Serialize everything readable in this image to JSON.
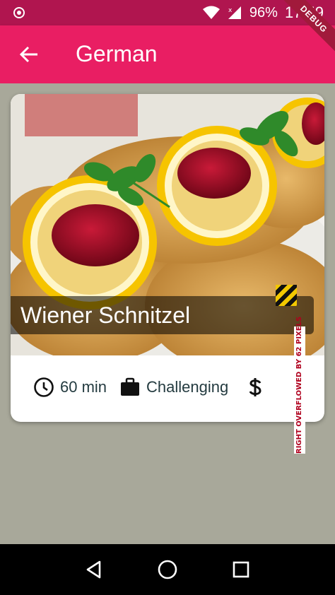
{
  "status_bar": {
    "battery": "96%",
    "time": "17:59"
  },
  "app_bar": {
    "title": "German",
    "debug_banner": "DEBUG"
  },
  "meal": {
    "title": "Wiener Schnitzel",
    "duration": "60 min",
    "complexity": "Challenging",
    "affordability_icon": "dollar-icon"
  },
  "overflow": {
    "label": "RIGHT OVERFLOWED BY 62 PIXELS"
  },
  "colors": {
    "status_bar": "#b0154f",
    "app_bar": "#e91e63",
    "background": "#a8a89a",
    "meta_text": "#243b40"
  }
}
